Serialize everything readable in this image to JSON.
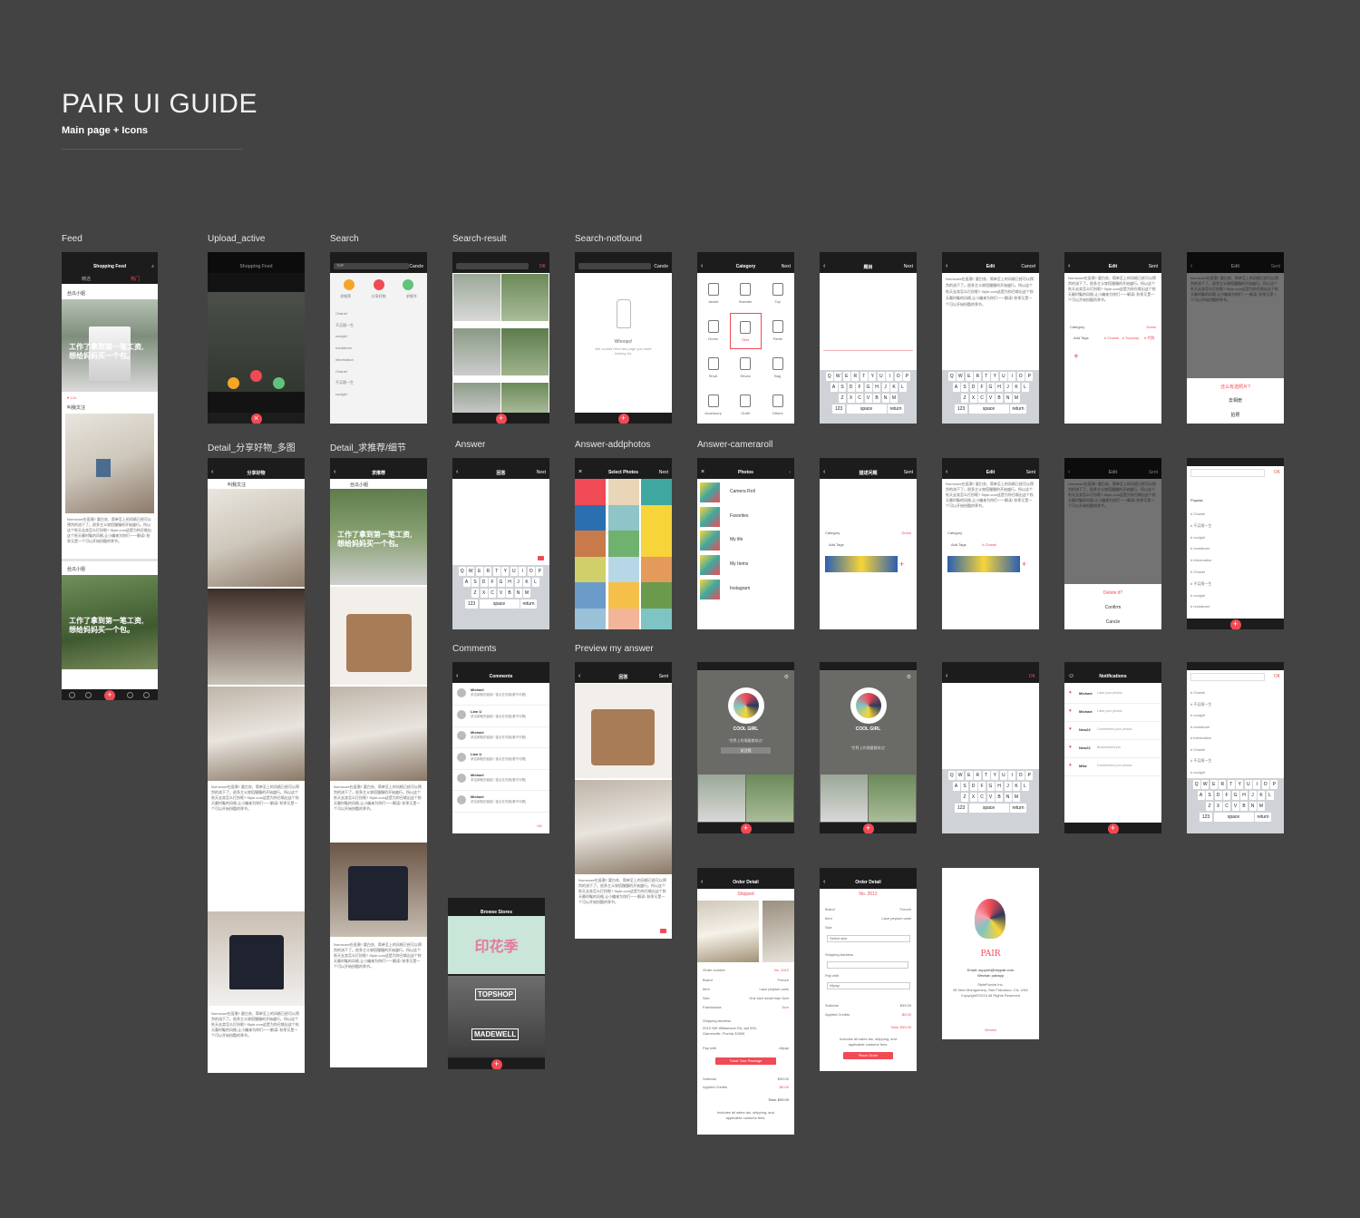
{
  "header": {
    "title": "PAIR UI GUIDE",
    "subtitle": "Main page + Icons"
  },
  "labels": {
    "feed": "Feed",
    "upload": "Upload_active",
    "search": "Search",
    "search_result": "Search-result",
    "search_notfound": "Search-notfound",
    "detail_multi": "Detail_分享好物_多图",
    "detail_rec": "Detail_求推荐/细节",
    "answer": "Answer",
    "answer_addphotos": "Answer-addphotos",
    "answer_cameraroll": "Answer-cameraroll",
    "comments": "Comments",
    "preview": "Preview my answer"
  },
  "nav": {
    "shopping_feed": "Shopping Feed",
    "category": "Category",
    "next": "Next",
    "edit": "Edit",
    "cancel": "Cancel",
    "sent": "Sent",
    "answer_title": "回答",
    "select_photos": "Select Photos",
    "photos": "Photos",
    "comments": "Comments",
    "browse_stores": "Browse Stores",
    "order_detail": "Order Detail",
    "notifications": "Notifications",
    "ok": "OK",
    "detail_share": "分享好物",
    "detail_rec": "求推荐",
    "describe": "描述问题",
    "question_title": "题目"
  },
  "feed": {
    "tab_left": "精选",
    "tab_right": "热门",
    "user1": "丝瓜小姐",
    "user2": "叫我文汪",
    "overlay": [
      "工作了拿到第一笔工资,",
      "想给妈妈买一个包。"
    ],
    "tag": "# BAG",
    "count": "124",
    "comments": "38"
  },
  "search": {
    "chips": [
      "求推荐",
      "分享好物",
      "求细节"
    ],
    "history": [
      "Chanel",
      "不买随一生",
      "coolgirl",
      "nordstrom",
      "information",
      "Chanel",
      "不买随一生",
      "coolgirl"
    ],
    "cancel": "Cancle",
    "top": "TOP"
  },
  "notfound": {
    "title": "Whoops!",
    "msg": "We couldn't find the page you were looking for."
  },
  "category": {
    "items": [
      "Jacket",
      "Sweater",
      "Top",
      "Dress",
      "Skirt",
      "Pants",
      "Short",
      "Shoes",
      "Bag",
      "Accessory",
      "Outfit",
      "Others"
    ]
  },
  "keyboard": {
    "row1": [
      "Q",
      "W",
      "E",
      "R",
      "T",
      "Y",
      "U",
      "I",
      "O",
      "P"
    ],
    "row2": [
      "A",
      "S",
      "D",
      "F",
      "G",
      "H",
      "J",
      "K",
      "L"
    ],
    "row3": [
      "Z",
      "X",
      "C",
      "V",
      "B",
      "N",
      "M"
    ],
    "space": "space",
    "ret": "return",
    "num": "123"
  },
  "edit": {
    "body": "Normcore在逛潮? 要白衣、简单至上的风格已经可以预判的流下了。很多主义穿搭慢慢的开始盛行。所以这个秋天去卖怎么打扮呢? Style.com这是为你召唤出这个秋天最时髦的风格,让小编来为你们一一解读! 秋季又是一个可以开始扮酷的季节。",
    "category": "Category",
    "dress": "Dress",
    "add_tags": "Add Tags",
    "tags": [
      "# Chanel",
      "# Topshop",
      "# 代购"
    ],
    "sheet_q": "还么有选照片?",
    "sheet_a": "去相册",
    "sheet_b": "拍照",
    "delete_q": "Delete it?",
    "confirm": "Confirm",
    "cancle": "Cancle"
  },
  "rolls": {
    "items": [
      "Camera Roll",
      "Favorites",
      "My life",
      "My Items",
      "Instagram"
    ]
  },
  "profile": {
    "name": "COOL GIRL",
    "quote": "\"世界上的潮量都穿过\"",
    "follow": "关注我"
  },
  "comments": {
    "names": [
      "Michael",
      "Lian U",
      "Michael",
      "Lian U",
      "Michael",
      "Michael"
    ],
    "text": "求这款鞋的链接? 重点在衣服(看不尽着)",
    "ok": "OK"
  },
  "notifications": {
    "items": [
      [
        "Michael",
        "Liked your photos"
      ],
      [
        "Michael",
        "Liked your photos"
      ],
      [
        "New22",
        "Commented your photos"
      ],
      [
        "New22",
        "Bookmarked you"
      ],
      [
        "Mike",
        "Commented your photos"
      ]
    ]
  },
  "tagsearch": {
    "popular": "Popular",
    "items": [
      "# Chanel",
      "# 不买随一生",
      "# coolgirl",
      "# nordstrom",
      "# information",
      "# Chanel",
      "# 不买随一生",
      "# coolgirl",
      "# nordstrom"
    ]
  },
  "order": {
    "shipped": "Shipped",
    "order_number": "Order number",
    "no": "No. 2012",
    "brand": "Brand",
    "brand_v": "French",
    "item": "Item",
    "item_v": "Lace peplum cami",
    "size": "Size",
    "size_v": "One size small than 5cm",
    "fashionista": "Fashionista",
    "fash_v": "5cm",
    "ship_addr": "Shipping Address",
    "addr": "2019 SW Williamson Rd, apt 999, Gainesville, Florida 32609",
    "pay_with": "Pay with",
    "alipay": "Alipay",
    "track": "Track Your Package",
    "subtotal": "Subtotal",
    "sub_v": "$39.00",
    "credits": "Applied Credits",
    "cred_v": "-$0.00",
    "total": "Total: $39.00",
    "note": "Includes all sales tax, shipping, and applicable customs fees.",
    "place": "Place Order",
    "size_ph": "Select size",
    "shipping": "Shipping Address"
  },
  "stores": {
    "a": "印花季",
    "b": "TOPSHOP",
    "c": "MADEWELL"
  },
  "about": {
    "logo": "PAIR",
    "email": "Email: support@heypair.com",
    "wechat": "Wechat: pairapp",
    "company": "StylePuzzle Inc.",
    "addr": "55 New Montgomery, San Francisco, CA, USA",
    "copy": "Copyright©2015 All Rights Reserved",
    "version": "Version"
  }
}
